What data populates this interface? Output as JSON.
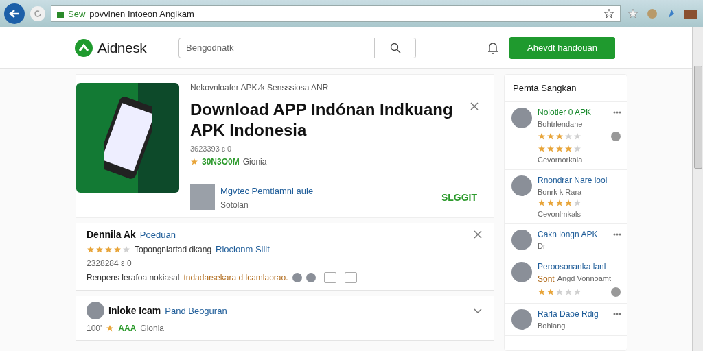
{
  "browser": {
    "url_prefix": "Sew",
    "url": "povvinen Intoeon Angikam"
  },
  "header": {
    "logo": "Aidnesk",
    "search": {
      "placeholder": "Bengodnatk"
    },
    "cta": "Ahevdt handouan"
  },
  "app": {
    "breadcrumb": "Nekovnloafer APK ⁄k Sensssiosa ANR",
    "title": "Download APP Indónan Indkuang APK Indonesia",
    "meta": "3623393 ɛ 0",
    "rating": "30N3O0M",
    "category": "Gionia",
    "developer": {
      "name": "Mgvtec Pemtlamnl aule",
      "sub": "Sotolan",
      "action": "SLGGIT"
    }
  },
  "reviews": [
    {
      "author": "Dennila Ak",
      "author_tag": "Poeduan",
      "stars": 4,
      "summary": "Topongnlartad dkang",
      "summary_link": "Rioclonm Slilt",
      "date": "2328284 ɛ 0",
      "body": "Renpens lerafoa nokiasal",
      "body_highlight": "tndadarsekara d lcamlaorao.",
      "expanded": true
    },
    {
      "author": "Inloke Icam",
      "author_tag": "Pand Beoguran",
      "count": "100'",
      "tags": "AAA",
      "category": "Gionia",
      "expanded": false
    }
  ],
  "sidebar": {
    "title": "Pemta Sangkan",
    "items": [
      {
        "name": "Nolotier 0 APK",
        "color": "#1a8a2e",
        "sub": "Bohtrlendane",
        "ratings": [
          {
            "stars": 3
          },
          {
            "stars": 4
          }
        ],
        "note": "Cevornorkala",
        "more": true,
        "reply": true
      },
      {
        "name": "Rnondrar Nare lool",
        "color": "#1f5d99",
        "sub": "Bonrk k Rara",
        "ratings": [
          {
            "stars": 4
          }
        ],
        "note": "Cevonlmkals"
      },
      {
        "name": "Cakn longn APK",
        "color": "#1f5d99",
        "sub": "Dr",
        "more": true
      },
      {
        "name": "Peroosonanka lanl",
        "color": "#1f5d99",
        "sub_tag": "Sont",
        "sub": "Angd Vonnoamt",
        "ratings": [
          {
            "stars": 2
          }
        ],
        "reply": true
      },
      {
        "name": "Rarla Daoe Rdig",
        "color": "#1f5d99",
        "sub": "Bohlang",
        "more": true
      }
    ]
  }
}
